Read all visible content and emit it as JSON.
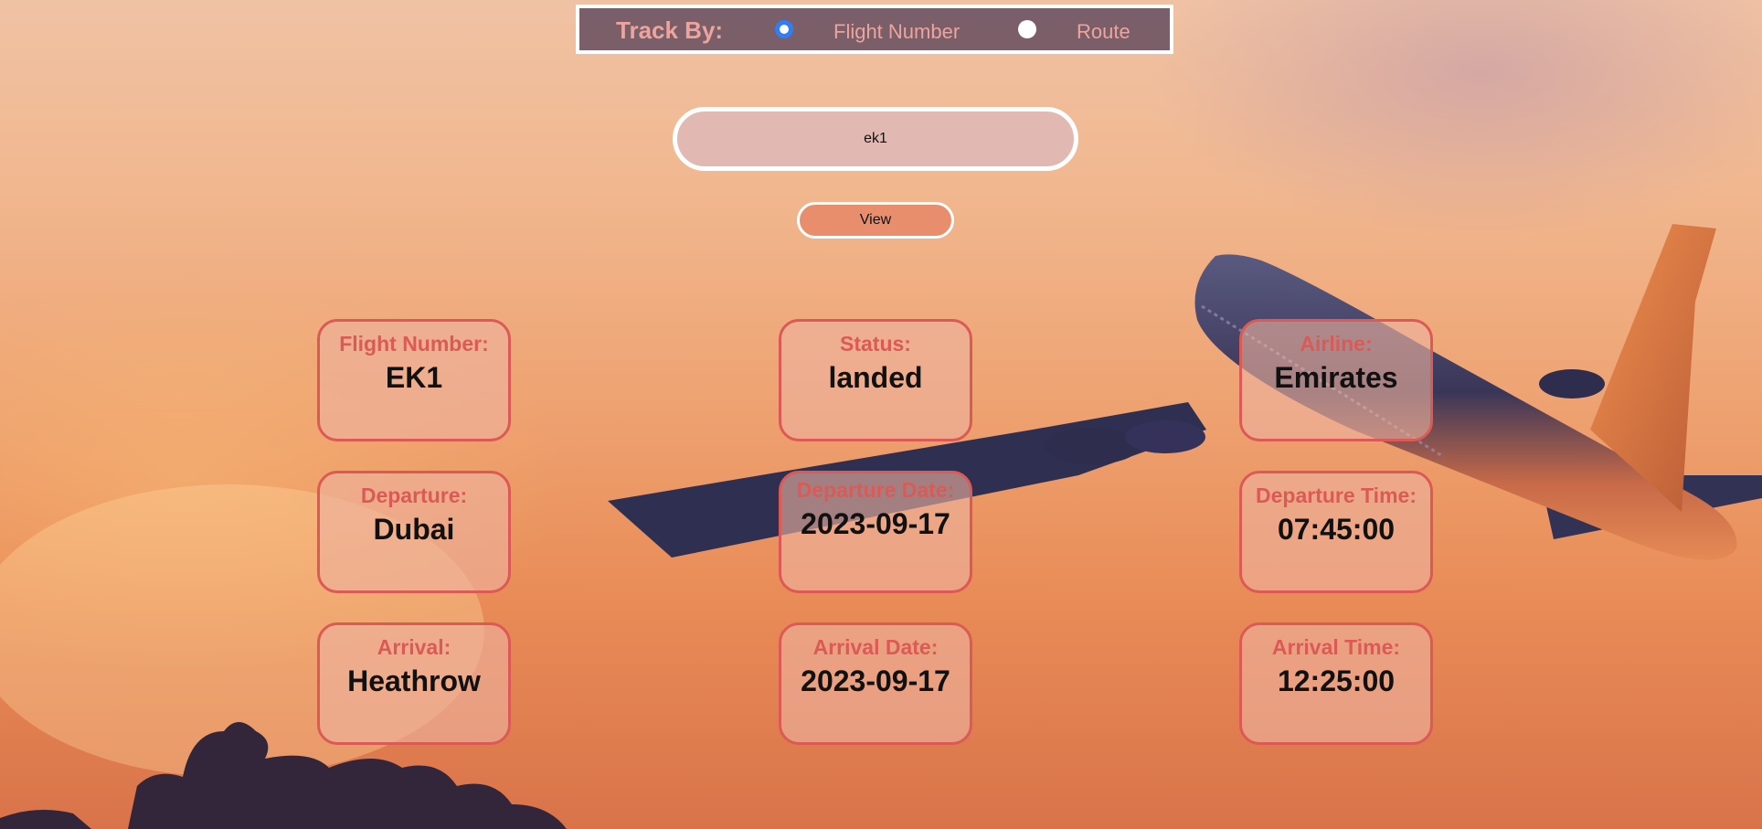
{
  "track_by": {
    "title": "Track By:",
    "options": [
      {
        "label": "Flight Number",
        "selected": true
      },
      {
        "label": "Route",
        "selected": false
      }
    ]
  },
  "search": {
    "value": "ek1"
  },
  "view_button": {
    "label": "View"
  },
  "cards": [
    {
      "label": "Flight Number:",
      "value": "EK1"
    },
    {
      "label": "Status:",
      "value": "landed"
    },
    {
      "label": "Airline:",
      "value": "Emirates"
    },
    {
      "label": "Departure:",
      "value": "Dubai"
    },
    {
      "label": "Departure Date:",
      "value": "2023-09-17"
    },
    {
      "label": "Departure Time:",
      "value": "07:45:00"
    },
    {
      "label": "Arrival:",
      "value": "Heathrow"
    },
    {
      "label": "Arrival Date:",
      "value": "2023-09-17"
    },
    {
      "label": "Arrival Time:",
      "value": "12:25:00"
    }
  ],
  "colors": {
    "card_border": "#dc5a55",
    "radio_selected": "#2f7ef6",
    "button_bg": "#e98e6c"
  },
  "icons": {
    "background": "airplane-sunset-background"
  }
}
